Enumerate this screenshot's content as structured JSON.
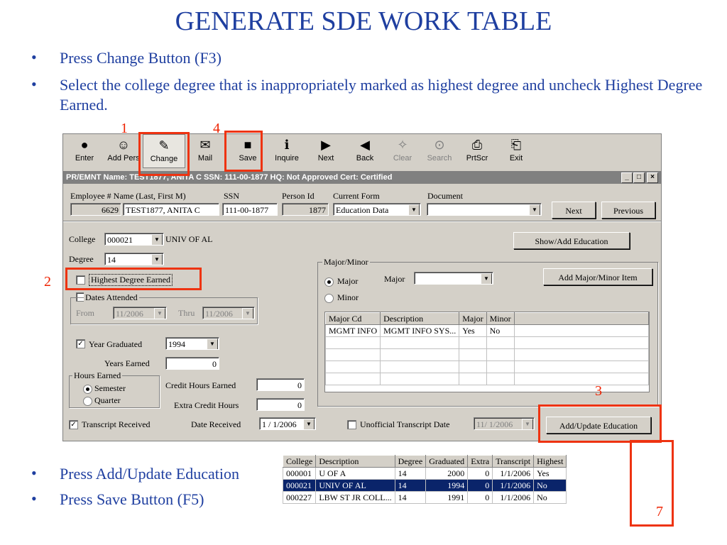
{
  "slide": {
    "title": "GENERATE SDE WORK TABLE",
    "bullets_top": [
      "Press Change Button (F3)",
      "Select the college degree that is inappropriately marked as highest degree and uncheck Highest Degree Earned."
    ],
    "bullets_bottom": [
      "Press Add/Update Education",
      "Press Save Button (F5)"
    ],
    "bullet_glyph": "•",
    "callouts": [
      "1",
      "4",
      "2",
      "3",
      "7"
    ]
  },
  "toolbar": {
    "buttons": [
      {
        "label": "Enter",
        "icon": "traffic-light-icon",
        "glyph": "●"
      },
      {
        "label": "Add Pers",
        "icon": "add-person-icon",
        "glyph": "☺"
      },
      {
        "label": "Change",
        "icon": "change-icon",
        "glyph": "✎"
      },
      {
        "label": "Mail",
        "icon": "mail-icon",
        "glyph": "✉"
      },
      {
        "label": "Save",
        "icon": "save-disk-icon",
        "glyph": "■"
      },
      {
        "label": "Inquire",
        "icon": "info-icon",
        "glyph": "ℹ"
      },
      {
        "label": "Next",
        "icon": "next-arrow-icon",
        "glyph": "▶"
      },
      {
        "label": "Back",
        "icon": "back-arrow-icon",
        "glyph": "◀"
      },
      {
        "label": "Clear",
        "icon": "broom-icon",
        "glyph": "✧"
      },
      {
        "label": "Search",
        "icon": "binoculars-icon",
        "glyph": "⊙"
      },
      {
        "label": "PrtScr",
        "icon": "printer-icon",
        "glyph": "⎙"
      },
      {
        "label": "Exit",
        "icon": "exit-icon",
        "glyph": "⎗"
      }
    ]
  },
  "window": {
    "title": "PR/EMNT  Name: TEST1877, ANITA C SSN: 111-00-1877 HQ: Not Approved Cert: Certified",
    "controls": [
      "_",
      "□",
      "×"
    ]
  },
  "header": {
    "labels": {
      "employee": "Employee # Name (Last, First M)",
      "ssn": "SSN",
      "person_id": "Person Id",
      "current_form": "Current Form",
      "document": "Document"
    },
    "employee_num": "6629",
    "name": "TEST1877, ANITA C",
    "ssn": "111-00-1877",
    "person_id": "1877",
    "current_form": "Education Data",
    "document": "",
    "next_label": "Next",
    "previous_label": "Previous"
  },
  "form": {
    "college_label": "College",
    "college_code": "000021",
    "college_name": "UNIV OF AL",
    "degree_label": "Degree",
    "degree": "14",
    "highest_degree_label": "Highest Degree Earned",
    "dates_attended_label": "Dates Attended",
    "from_label": "From",
    "from_value": "11/2006",
    "thru_label": "Thru",
    "thru_value": "11/2006",
    "year_graduated_label": "Year Graduated",
    "year_graduated": "1994",
    "years_earned_label": "Years Earned",
    "years_earned": "0",
    "hours_earned_label": "Hours Earned",
    "semester_label": "Semester",
    "quarter_label": "Quarter",
    "credit_hours_label": "Credit Hours Earned",
    "credit_hours": "0",
    "extra_credit_label": "Extra Credit Hours",
    "extra_credit": "0",
    "transcript_received_label": "Transcript Received",
    "date_received_label": "Date Received",
    "date_received": "1 / 1/2006",
    "unofficial_label": "Unofficial Transcript Date",
    "unofficial_date": "11/ 1/2006",
    "show_add_label": "Show/Add Education",
    "add_update_label": "Add/Update Education"
  },
  "major_minor": {
    "group_label": "Major/Minor",
    "major_radio": "Major",
    "minor_radio": "Minor",
    "major_label": "Major",
    "major_value": "",
    "add_item_label": "Add Major/Minor Item",
    "columns": [
      "Major Cd",
      "Description",
      "Major",
      "Minor"
    ],
    "rows": [
      [
        "MGMT INFO",
        "MGMT INFO SYS...",
        "Yes",
        "No"
      ]
    ]
  },
  "education_table": {
    "columns": [
      "College",
      "Description",
      "Degree",
      "Graduated",
      "Extra",
      "Transcript",
      "Highest"
    ],
    "rows": [
      [
        "000001",
        "U OF A",
        "14",
        "2000",
        "0",
        "1/1/2006",
        "Yes"
      ],
      [
        "000021",
        "UNIV OF AL",
        "14",
        "1994",
        "0",
        "1/1/2006",
        "No"
      ],
      [
        "000227",
        "LBW ST JR COLL...",
        "14",
        "1991",
        "0",
        "1/1/2006",
        "No"
      ]
    ],
    "selected_row": 1
  }
}
